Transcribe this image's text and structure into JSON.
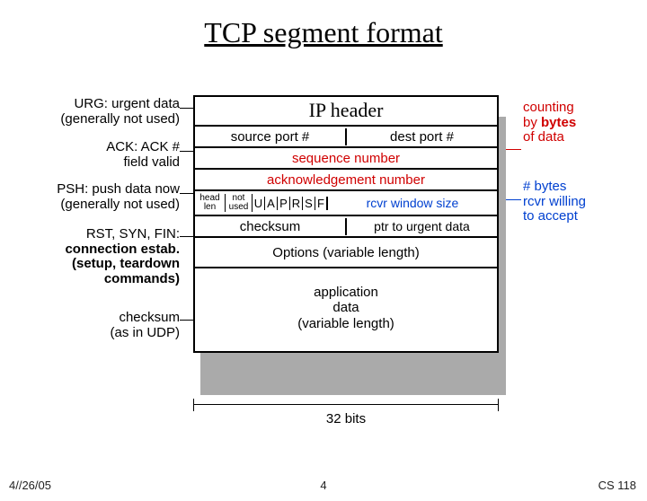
{
  "title": "TCP segment format",
  "left": {
    "urg": {
      "l1": "URG: urgent data",
      "l2": "(generally not used)"
    },
    "ack": {
      "l1": "ACK: ACK #",
      "l2": "field valid"
    },
    "psh": {
      "l1": "PSH: push data now",
      "l2": "(generally not used)"
    },
    "rst": {
      "l1": "RST, SYN, FIN:",
      "l2": "connection estab.",
      "l3": "(setup, teardown",
      "l4": "commands)"
    },
    "chk": {
      "l1": "checksum",
      "l2": "(as in UDP)"
    }
  },
  "right": {
    "counting": {
      "l1": "counting",
      "l2pre": "by ",
      "l2b": "bytes",
      "l3": "of data"
    },
    "bytes": {
      "l1": "# bytes",
      "l2": "rcvr willing",
      "l3": "to accept"
    }
  },
  "seg": {
    "ip": "IP header",
    "srcport": "source port #",
    "dstport": "dest port #",
    "seq": "sequence number",
    "ack": "acknowledgement number",
    "hlen1": "head",
    "hlen2": "len",
    "notused1": "not",
    "notused2": "used",
    "flags": {
      "U": "U",
      "A": "A",
      "P": "P",
      "R": "R",
      "S": "S",
      "F": "F"
    },
    "rwnd": "rcvr window size",
    "checksum": "checksum",
    "urgptr": "ptr to urgent data",
    "options": "Options (variable length)",
    "app1": "application",
    "app2": "data",
    "app3": "(variable length)",
    "width": "32 bits"
  },
  "footer": {
    "date": "4//26/05",
    "page": "4",
    "course": "CS 118"
  }
}
